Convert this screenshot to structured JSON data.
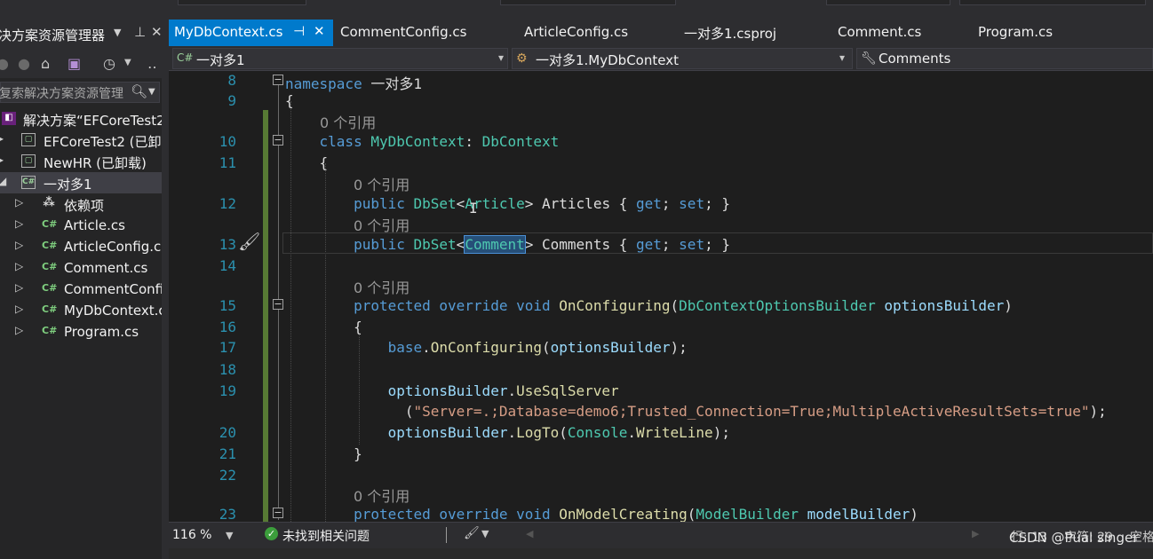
{
  "solution_explorer": {
    "title": "决方案资源管理器",
    "search_placeholder": "复索解决方案资源管理",
    "tree": [
      {
        "label": "解决方案“EFCoreTest2",
        "icon": "solution-icon"
      },
      {
        "label": "EFCoreTest2 (已卸",
        "icon": "project-icon"
      },
      {
        "label": "NewHR (已卸载)",
        "icon": "project-icon"
      },
      {
        "label": "一对多1",
        "icon": "csharp-project-icon"
      },
      {
        "label": "依赖项",
        "icon": "dependencies-icon"
      },
      {
        "label": "Article.cs",
        "icon": "csharp-file-icon"
      },
      {
        "label": "ArticleConfig.cs",
        "icon": "csharp-file-icon"
      },
      {
        "label": "Comment.cs",
        "icon": "csharp-file-icon"
      },
      {
        "label": "CommentConfi",
        "icon": "csharp-file-icon"
      },
      {
        "label": "MyDbContext.c",
        "icon": "csharp-file-icon"
      },
      {
        "label": "Program.cs",
        "icon": "csharp-file-icon"
      }
    ]
  },
  "tabs": [
    {
      "label": "MyDbContext.cs",
      "active": true
    },
    {
      "label": "CommentConfig.cs"
    },
    {
      "label": "ArticleConfig.cs"
    },
    {
      "label": "一对多1.csproj"
    },
    {
      "label": "Comment.cs"
    },
    {
      "label": "Program.cs"
    }
  ],
  "nav_bar": {
    "project": "一对多1",
    "type": "一对多1.MyDbContext",
    "member": "Comments"
  },
  "editor": {
    "line_numbers": [
      "8",
      "9",
      "10",
      "11",
      "12",
      "13",
      "14",
      "15",
      "16",
      "17",
      "18",
      "19",
      "20",
      "21",
      "22",
      "23"
    ],
    "reference_label": "0 个引用",
    "code": {
      "l8_ns": "namespace",
      "l8_name": "一对多1",
      "l9": "{",
      "l10_class": "class",
      "l10_name": "MyDbContext",
      "l10_colon": ":",
      "l10_base": "DbContext",
      "l11": "{",
      "l12_public": "public",
      "l12_dbset": "DbSet",
      "l12_lt": "<",
      "l12_t": "Article",
      "l12_rest": "> Articles {",
      "l12_get": "get",
      "l12_semi": ";",
      "l12_set": "set",
      "l12_end": "; }",
      "l13_public": "public",
      "l13_dbset": "DbSet",
      "l13_lt": "<",
      "l13_t": "Comment",
      "l13_rest": "> Comments {",
      "l13_get": "get",
      "l13_semi": ";",
      "l13_set": "set",
      "l13_end": "; }",
      "l15_protected": "protected",
      "l15_override": "override",
      "l15_void": "void",
      "l15_method": "OnConfiguring",
      "l15_paren": "(",
      "l15_ptype": "DbContextOptionsBuilder",
      "l15_pname": "optionsBuilder",
      "l15_close": ")",
      "l16": "{",
      "l17_base": "base",
      "l17_dot": ".",
      "l17_method": "OnConfiguring",
      "l17_open": "(",
      "l17_arg": "optionsBuilder",
      "l17_close": ");",
      "l19_obj": "optionsBuilder",
      "l19_dot": ".",
      "l19_method": "UseSqlServer",
      "l19b_open": "(",
      "l19b_str": "\"Server=.;Database=demo6;Trusted_Connection=True;MultipleActiveResultSets=true\"",
      "l19b_close": ");",
      "l20_obj": "optionsBuilder",
      "l20_dot": ".",
      "l20_method": "LogTo",
      "l20_open": "(",
      "l20_console": "Console",
      "l20_dot2": ".",
      "l20_writeline": "WriteLine",
      "l20_close": ");",
      "l21": "}",
      "l23_protected": "protected",
      "l23_override": "override",
      "l23_void": "void",
      "l23_method": "OnModelCreating",
      "l23_paren": "(",
      "l23_ptype": "ModelBuilder",
      "l23_pname": "modelBuilder",
      "l23_close": ")"
    }
  },
  "status_bar": {
    "zoom": "116 %",
    "issues": "未找到相关问题",
    "line": "行: 13",
    "col": "字符: 29",
    "space": "空格",
    "watermark": "CSDN @Pual singer"
  },
  "colors": {
    "accent": "#007acc",
    "keyword": "#569cd6",
    "type": "#4ec9b0",
    "method": "#dcdcaa",
    "parameter": "#9cdcfe",
    "string": "#d69d85",
    "line_number": "#2b91af",
    "change_bar": "#577a34"
  }
}
